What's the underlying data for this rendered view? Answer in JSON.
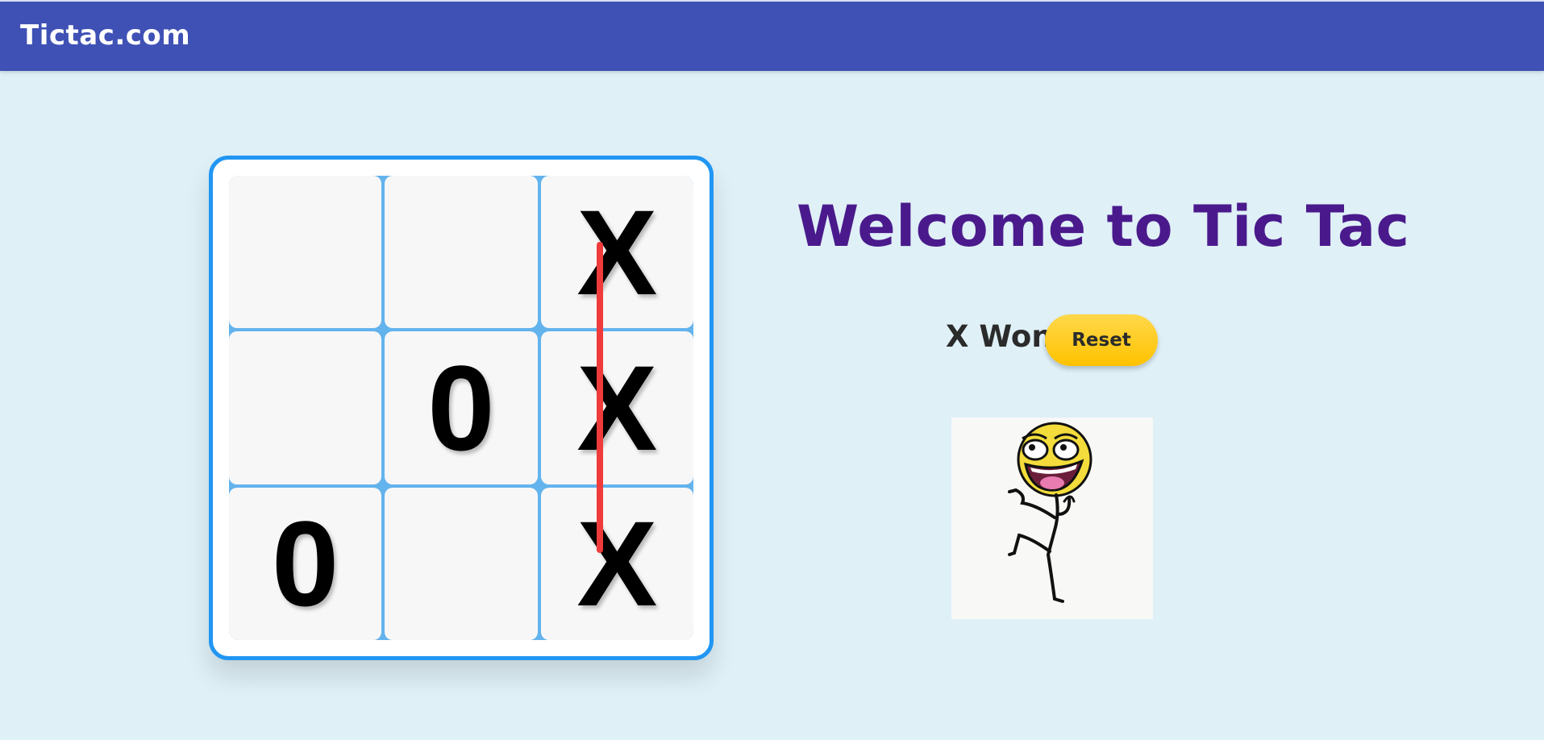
{
  "header": {
    "brand": "Tictac.com"
  },
  "game": {
    "board": [
      "",
      "",
      "X",
      "",
      "0",
      "X",
      "0",
      "",
      "X"
    ],
    "winning_line": "right-column",
    "status": "X Won",
    "reset_label": "Reset"
  },
  "hero": {
    "title": "Welcome to Tic Tac"
  },
  "colors": {
    "navbar": "#3f51b5",
    "background": "#dff0f7",
    "board_border": "#2196f3",
    "grid_lines": "#63b3ed",
    "win_line": "#ef3b3b",
    "title": "#4a1a8c",
    "reset_button": "#ffc800"
  },
  "image": {
    "icon": "happy-stick-figure"
  }
}
